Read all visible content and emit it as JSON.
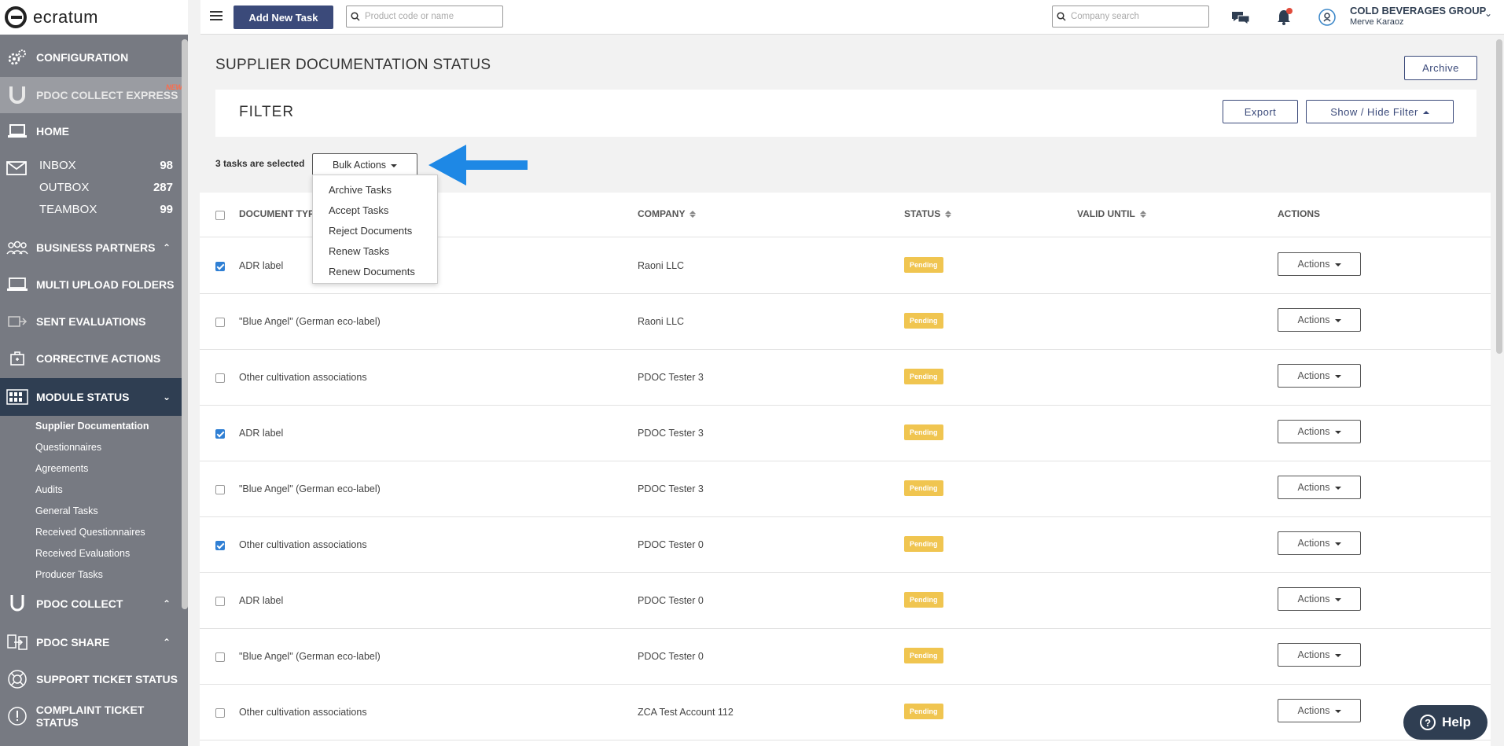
{
  "app": {
    "logo_text": "ecratum"
  },
  "colors": {
    "sidebar": "#777a82",
    "sidebar_active": "#2f3e52",
    "primary": "#3b4a7a",
    "pending": "#f0c550",
    "checkbox": "#2f7fd4",
    "arrow": "#1e88e5"
  },
  "sidebar": {
    "configuration": "CONFIGURATION",
    "pdoc_collect_express": "PDOC COLLECT EXPRESS",
    "new_badge": "NEW!",
    "home": "HOME",
    "inbox": {
      "label": "INBOX",
      "count": "98"
    },
    "outbox": {
      "label": "OUTBOX",
      "count": "287"
    },
    "teambox": {
      "label": "TEAMBOX",
      "count": "99"
    },
    "business_partners": "BUSINESS PARTNERS",
    "multi_upload_folders": "MULTI UPLOAD FOLDERS",
    "sent_evaluations": "SENT EVALUATIONS",
    "corrective_actions": "CORRECTIVE ACTIONS",
    "module_status": "MODULE STATUS",
    "module_sub": [
      "Supplier Documentation",
      "Questionnaires",
      "Agreements",
      "Audits",
      "General Tasks",
      "Received Questionnaires",
      "Received Evaluations",
      "Producer Tasks"
    ],
    "pdoc_collect": "PDOC COLLECT",
    "pdoc_share": "PDOC SHARE",
    "support_ticket_status": "SUPPORT TICKET STATUS",
    "complaint_ticket_status": "COMPLAINT TICKET STATUS"
  },
  "topbar": {
    "add_new_task": "Add New Task",
    "product_search_placeholder": "Product code or name",
    "company_search_placeholder": "Company search",
    "org_name": "COLD BEVERAGES GROUP",
    "user_name": "Merve Karaoz"
  },
  "main": {
    "page_title": "SUPPLIER DOCUMENTATION STATUS",
    "archive_button": "Archive",
    "filter_title": "FILTER",
    "export_button": "Export",
    "show_hide_filter": "Show / Hide Filter",
    "selected_text": "3 tasks are selected",
    "bulk_actions": "Bulk Actions",
    "bulk_menu": [
      "Archive Tasks",
      "Accept Tasks",
      "Reject Documents",
      "Renew Tasks",
      "Renew Documents"
    ]
  },
  "table": {
    "headers": {
      "document_type": "DOCUMENT TYPE",
      "company": "COMPANY",
      "status": "STATUS",
      "valid_until": "VALID UNTIL",
      "actions": "ACTIONS"
    },
    "actions_label": "Actions",
    "rows": [
      {
        "checked": true,
        "document_type": "ADR label",
        "company": "Raoni LLC",
        "status": "Pending"
      },
      {
        "checked": false,
        "document_type": "\"Blue Angel\" (German eco-label)",
        "company": "Raoni LLC",
        "status": "Pending"
      },
      {
        "checked": false,
        "document_type": "Other cultivation associations",
        "company": "PDOC Tester 3",
        "status": "Pending"
      },
      {
        "checked": true,
        "document_type": "ADR label",
        "company": "PDOC Tester 3",
        "status": "Pending"
      },
      {
        "checked": false,
        "document_type": "\"Blue Angel\" (German eco-label)",
        "company": "PDOC Tester 3",
        "status": "Pending"
      },
      {
        "checked": true,
        "document_type": "Other cultivation associations",
        "company": "PDOC Tester 0",
        "status": "Pending"
      },
      {
        "checked": false,
        "document_type": "ADR label",
        "company": "PDOC Tester 0",
        "status": "Pending"
      },
      {
        "checked": false,
        "document_type": "\"Blue Angel\" (German eco-label)",
        "company": "PDOC Tester 0",
        "status": "Pending"
      },
      {
        "checked": false,
        "document_type": "Other cultivation associations",
        "company": "ZCA Test Account 112",
        "status": "Pending"
      }
    ]
  },
  "help_button": "Help"
}
